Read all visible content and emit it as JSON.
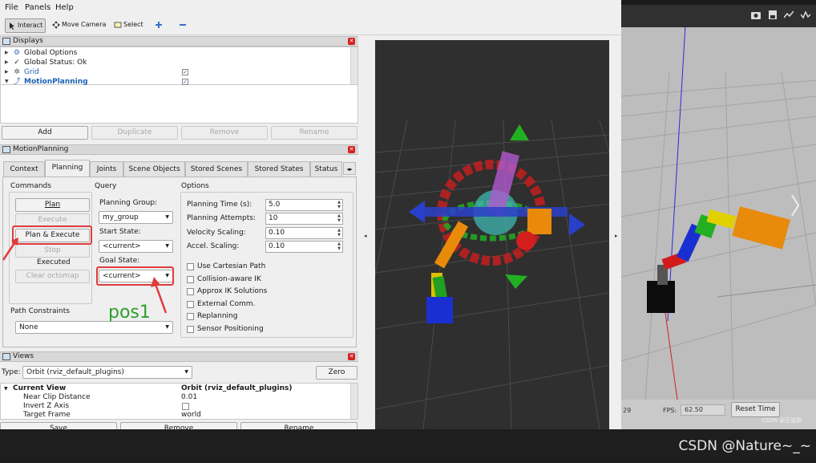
{
  "menu": [
    "File",
    "Panels",
    "Help"
  ],
  "toolbar": {
    "interact": "Interact",
    "move_camera": "Move Camera",
    "select": "Select"
  },
  "displays": {
    "title": "Displays",
    "items": [
      {
        "label": "Global Options",
        "checked": false
      },
      {
        "label": "Global Status: Ok",
        "checked": false
      },
      {
        "label": "Grid",
        "checked": true
      },
      {
        "label": "MotionPlanning",
        "checked": true
      }
    ],
    "buttons": {
      "add": "Add",
      "duplicate": "Duplicate",
      "remove": "Remove",
      "rename": "Rename"
    }
  },
  "motion_planning": {
    "title": "MotionPlanning",
    "tabs": [
      "Context",
      "Planning",
      "Joints",
      "Scene Objects",
      "Stored Scenes",
      "Stored States",
      "Status"
    ],
    "commands": {
      "heading": "Commands",
      "plan": "Plan",
      "execute": "Execute",
      "plan_execute": "Plan & Execute",
      "stop": "Stop",
      "status": "Executed",
      "clear_octomap": "Clear octomap"
    },
    "query": {
      "heading": "Query",
      "planning_group_label": "Planning Group:",
      "planning_group": "my_group",
      "start_state_label": "Start State:",
      "start_state": "<current>",
      "goal_state_label": "Goal State:",
      "goal_state": "<current>"
    },
    "options": {
      "heading": "Options",
      "fields": [
        {
          "label": "Planning Time (s):",
          "value": "5.0"
        },
        {
          "label": "Planning Attempts:",
          "value": "10"
        },
        {
          "label": "Velocity Scaling:",
          "value": "0.10"
        },
        {
          "label": "Accel. Scaling:",
          "value": "0.10"
        }
      ],
      "checks": [
        "Use Cartesian Path",
        "Collision-aware IK",
        "Approx IK Solutions",
        "External Comm.",
        "Replanning",
        "Sensor Positioning"
      ]
    },
    "path_constraints": {
      "label": "Path Constraints",
      "value": "None"
    },
    "annotation": "pos1"
  },
  "views": {
    "title": "Views",
    "type_label": "Type:",
    "type_value": "Orbit (rviz_default_plugins)",
    "zero": "Zero",
    "rows": [
      {
        "name": "Current View",
        "value": "Orbit (rviz_default_plugins)"
      },
      {
        "name": "Near Clip Distance",
        "value": "0.01"
      },
      {
        "name": "Invert Z Axis",
        "value": ""
      },
      {
        "name": "Target Frame",
        "value": "world"
      }
    ],
    "buttons": {
      "save": "Save",
      "remove": "Remove",
      "rename": "Rename"
    }
  },
  "gazebo": {
    "time_value": "29",
    "fps_label": "FPS:",
    "fps_value": "62.50",
    "reset_time": "Reset Time",
    "small_watermark": "CSDN @正弦钟"
  },
  "watermark": "CSDN @Nature~_~",
  "colors": {
    "annotation_red": "#e03c3c",
    "annotation_green": "#2ba02b"
  }
}
